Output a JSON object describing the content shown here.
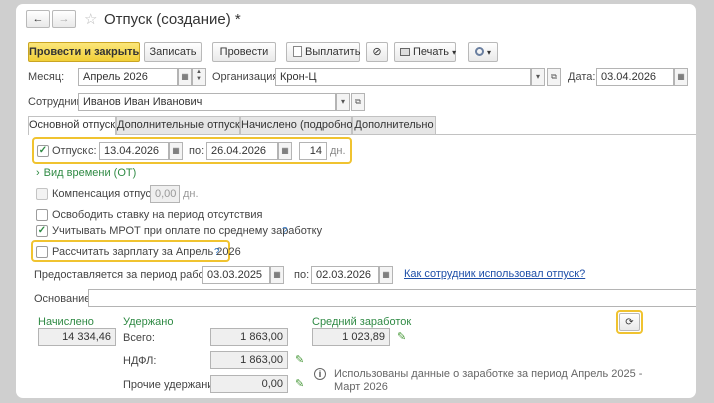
{
  "window": {
    "title": "Отпуск (создание) *",
    "nav_back": "←",
    "nav_forward": "→",
    "star": "☆"
  },
  "toolbar": {
    "post_close": "Провести и закрыть",
    "save": "Записать",
    "post": "Провести",
    "pay": "Выплатить",
    "print": "Печать",
    "print_arrow": "▾",
    "more_arrow": "▾"
  },
  "header": {
    "month_label": "Месяц:",
    "month_value": "Апрель 2026",
    "org_label": "Организация:",
    "org_value": "Крон-Ц",
    "date_label": "Дата:",
    "date_value": "03.04.2026",
    "employee_label": "Сотрудник:",
    "employee_value": "Иванов Иван Иванович"
  },
  "tabs": [
    "Основной отпуск",
    "Дополнительные отпуска",
    "Начислено (подробно)",
    "Дополнительно"
  ],
  "vacation": {
    "checkbox_label": "Отпуск",
    "from_label": "с:",
    "from_value": "13.04.2026",
    "to_label": "по:",
    "to_value": "26.04.2026",
    "days_value": "14",
    "days_unit": "дн.",
    "time_type": "Вид времени (ОТ)",
    "compensation_label": "Компенсация отпуска",
    "compensation_value": "0,00",
    "compensation_unit": "дн.",
    "release_rate": "Освободить ставку на период отсутствия",
    "mrot": "Учитывать МРОТ при оплате по среднему заработку",
    "mrot_help": "?",
    "calc_salary": "Рассчитать зарплату за Апрель 2026",
    "calc_help": "?"
  },
  "period": {
    "label": "Предоставляется за период работы с:",
    "from_value": "03.03.2025",
    "to_label": "по:",
    "to_value": "02.03.2026",
    "link": "Как сотрудник использовал отпуск?"
  },
  "basis": {
    "label": "Основание:",
    "value": ""
  },
  "totals": {
    "accrued_title": "Начислено",
    "accrued_value": "14 334,46",
    "withheld_title": "Удержано",
    "total_label": "Всего:",
    "total_value": "1 863,00",
    "ndfl_label": "НДФЛ:",
    "ndfl_value": "1 863,00",
    "other_label": "Прочие удержания:",
    "other_value": "0,00",
    "avg_title": "Средний заработок",
    "avg_value": "1 023,89",
    "info_text_1": "Использованы данные о заработке за период Апрель 2025 -",
    "info_text_2": "Март 2026"
  }
}
